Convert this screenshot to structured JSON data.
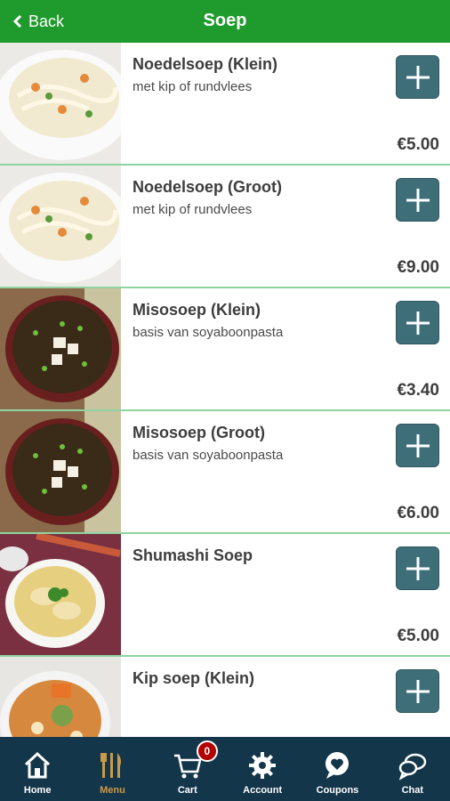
{
  "header": {
    "back_label": "Back",
    "title": "Soep"
  },
  "products": [
    {
      "name": "Noedelsoep (Klein)",
      "description": "met kip of rundvlees",
      "price": "€5.00",
      "image": "noodle-soup"
    },
    {
      "name": "Noedelsoep (Groot)",
      "description": "met kip of rundvlees",
      "price": "€9.00",
      "image": "noodle-soup"
    },
    {
      "name": "Misosoep (Klein)",
      "description": "basis van soyaboonpasta",
      "price": "€3.40",
      "image": "miso-soup"
    },
    {
      "name": "Misosoep (Groot)",
      "description": "basis van soyaboonpasta",
      "price": "€6.00",
      "image": "miso-soup"
    },
    {
      "name": "Shumashi Soep",
      "description": "",
      "price": "€5.00",
      "image": "dumpling-soup"
    },
    {
      "name": "Kip soep (Klein)",
      "description": "",
      "price": "",
      "image": "chicken-soup"
    }
  ],
  "tabbar": {
    "items": [
      {
        "label": "Home",
        "icon": "home-icon",
        "active": false
      },
      {
        "label": "Menu",
        "icon": "fork-knife-icon",
        "active": true
      },
      {
        "label": "Cart",
        "icon": "cart-icon",
        "active": false,
        "badge": "0"
      },
      {
        "label": "Account",
        "icon": "gear-icon",
        "active": false
      },
      {
        "label": "Coupons",
        "icon": "heart-bubble-icon",
        "active": false
      },
      {
        "label": "Chat",
        "icon": "chat-icon",
        "active": false
      }
    ]
  },
  "colors": {
    "header": "#1f9a2c",
    "tabbar": "#14364a",
    "add_button": "#3e6e78",
    "active_tab": "#c99a4a",
    "divider": "#8fd3a0"
  }
}
